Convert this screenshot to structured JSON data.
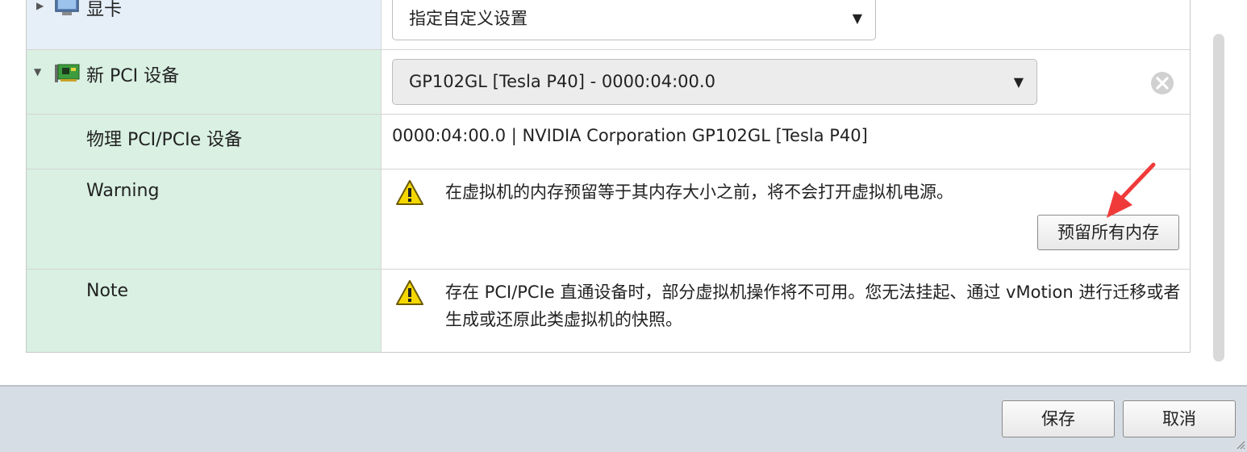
{
  "rows": {
    "gpu": {
      "label": "显卡",
      "select_value": "指定自定义设置"
    },
    "new_pci": {
      "label": "新 PCI 设备",
      "select_value": "GP102GL [Tesla P40] - 0000:04:00.0"
    },
    "physical": {
      "label": "物理 PCI/PCIe 设备",
      "value": "0000:04:00.0 | NVIDIA Corporation GP102GL [Tesla P40]"
    },
    "warning": {
      "label": "Warning",
      "message": "在虚拟机的内存预留等于其内存大小之前，将不会打开虚拟机电源。",
      "button_label": "预留所有内存"
    },
    "note": {
      "label": "Note",
      "message": "存在 PCI/PCIe 直通设备时，部分虚拟机操作将不可用。您无法挂起、通过 vMotion 进行迁移或者生成或还原此类虚拟机的快照。"
    }
  },
  "footer": {
    "save_label": "保存",
    "cancel_label": "取消"
  },
  "icons": [
    "expand-right-icon",
    "monitor-icon",
    "collapse-down-icon",
    "pci-card-icon",
    "remove-icon",
    "warning-icon",
    "dropdown-arrow-icon",
    "resize-grip-icon"
  ],
  "colors": {
    "gpu_row": "#e6eff7",
    "pci_rows": "#d9f0e3",
    "footer": "#d7dde4",
    "annotation_arrow": "#f03a3a",
    "warning_icon": "#f5d800"
  }
}
